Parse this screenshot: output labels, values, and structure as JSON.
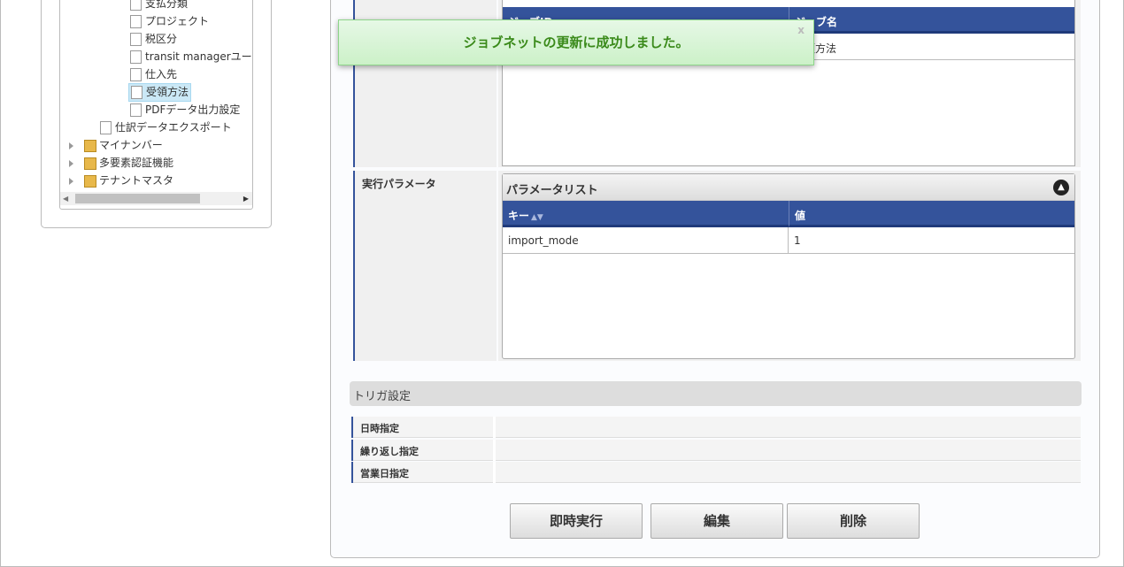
{
  "tree": {
    "items": [
      {
        "label": "支払分類",
        "type": "doc",
        "level": 2
      },
      {
        "label": "プロジェクト",
        "type": "doc",
        "level": 2
      },
      {
        "label": "税区分",
        "type": "doc",
        "level": 2
      },
      {
        "label": "transit managerユーザ",
        "type": "doc",
        "level": 2
      },
      {
        "label": "仕入先",
        "type": "doc",
        "level": 2
      },
      {
        "label": "受領方法",
        "type": "doc",
        "level": 2,
        "selected": true
      },
      {
        "label": "PDFデータ出力設定",
        "type": "doc",
        "level": 2
      },
      {
        "label": "仕訳データエクスポート",
        "type": "doc",
        "level": 1
      },
      {
        "label": "マイナンバー",
        "type": "folder",
        "level": 0
      },
      {
        "label": "多要素認証機能",
        "type": "folder",
        "level": 0
      },
      {
        "label": "テナントマスタ",
        "type": "folder",
        "level": 0
      }
    ]
  },
  "job_grid": {
    "col_id": "ジョブID",
    "col_name": "ジョブ名",
    "row_name": "受領方法"
  },
  "params": {
    "label": "実行パラメータ",
    "caption": "パラメータリスト",
    "col_key": "キー",
    "col_value": "値",
    "rows": [
      {
        "key": "import_mode",
        "value": "1"
      }
    ]
  },
  "trigger": {
    "title": "トリガ設定",
    "rows": [
      "日時指定",
      "繰り返し指定",
      "営業日指定"
    ]
  },
  "buttons": {
    "run": "即時実行",
    "edit": "編集",
    "delete": "削除"
  },
  "toast": {
    "message": "ジョブネットの更新に成功しました。",
    "close": "x"
  }
}
